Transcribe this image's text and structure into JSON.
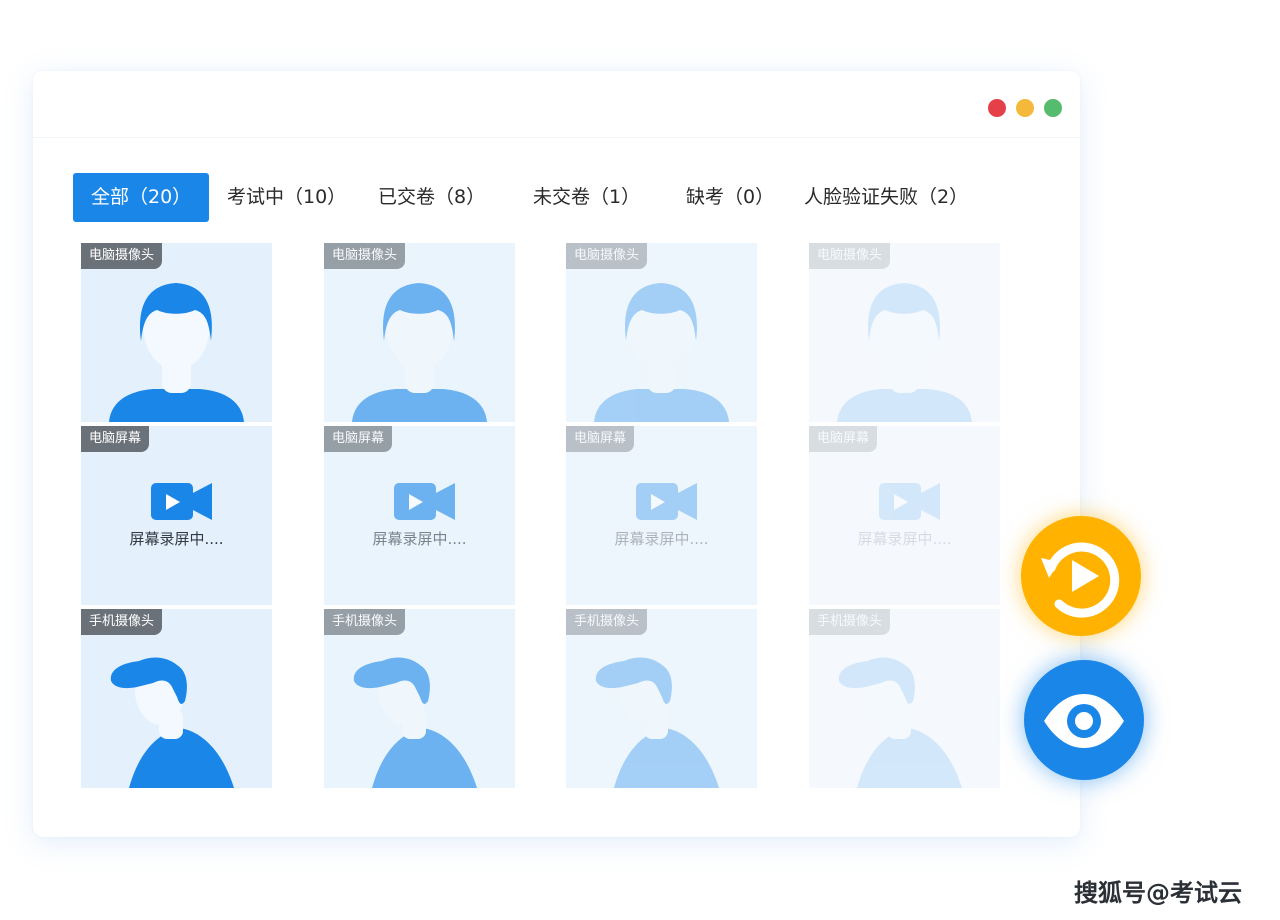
{
  "window": {
    "controls": {
      "close_color": "#e5404a",
      "minimize_color": "#f4b93a",
      "zoom_color": "#55bc6e"
    }
  },
  "tabs": [
    {
      "label": "全部（20）",
      "active": true
    },
    {
      "label": "考试中（10）",
      "active": false
    },
    {
      "label": "已交卷（8）",
      "active": false
    },
    {
      "label": "未交卷（1）",
      "active": false
    },
    {
      "label": "缺考（0）",
      "active": false
    },
    {
      "label": "人脸验证失败（2）",
      "active": false
    }
  ],
  "students": [
    {
      "pc_cam": "电脑摄像头",
      "screen": "电脑屏幕",
      "screen_status": "屏幕录屏中....",
      "phone_cam": "手机摄像头",
      "opacity": 1.0
    },
    {
      "pc_cam": "电脑摄像头",
      "screen": "电脑屏幕",
      "screen_status": "屏幕录屏中....",
      "phone_cam": "手机摄像头",
      "opacity": 0.6
    },
    {
      "pc_cam": "电脑摄像头",
      "screen": "电脑屏幕",
      "screen_status": "屏幕录屏中....",
      "phone_cam": "手机摄像头",
      "opacity": 0.35
    },
    {
      "pc_cam": "电脑摄像头",
      "screen": "电脑屏幕",
      "screen_status": "屏幕录屏中....",
      "phone_cam": "手机摄像头",
      "opacity": 0.15
    }
  ],
  "actions": {
    "replay_icon": "replay-icon",
    "view_icon": "eye-icon"
  },
  "colors": {
    "accent": "#1a86e8",
    "replay": "#ffb300",
    "tag_bg": "#6b7178",
    "cell_bg": "#e4f1fc"
  },
  "watermark": "搜狐号@考试云"
}
